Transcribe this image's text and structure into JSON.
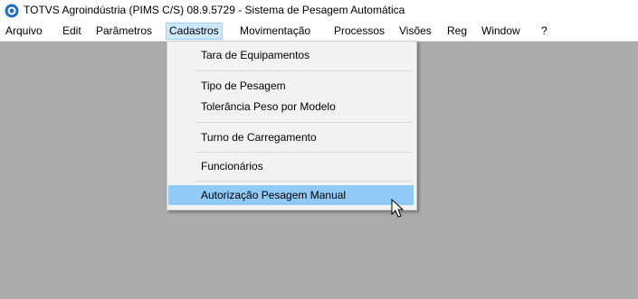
{
  "window": {
    "title": "TOTVS Agroindústria (PIMS C/S) 08.9.5729 - Sistema de Pesagem Automática",
    "icon": "totvs-logo-icon"
  },
  "menubar": {
    "items": [
      {
        "label": "Arquivo"
      },
      {
        "label": "Edit"
      },
      {
        "label": "Parâmetros"
      },
      {
        "label": "Cadastros",
        "active": true
      },
      {
        "label": "Movimentação"
      },
      {
        "label": "Processos"
      },
      {
        "label": "Visões"
      },
      {
        "label": "Reg"
      },
      {
        "label": "Window"
      },
      {
        "label": "?"
      }
    ]
  },
  "dropdown": {
    "items": [
      {
        "label": "Tara de Equipamentos"
      },
      {
        "label": "Tipo de Pesagem"
      },
      {
        "label": "Tolerância Peso por Modelo"
      },
      {
        "label": "Turno de Carregamento"
      },
      {
        "label": "Funcionários"
      },
      {
        "label": "Autorização Pesagem Manual",
        "highlighted": true
      }
    ]
  },
  "colors": {
    "workspace": "#ababab",
    "menu_highlight": "#91c9f7",
    "active_menu": "#cce8ff"
  }
}
